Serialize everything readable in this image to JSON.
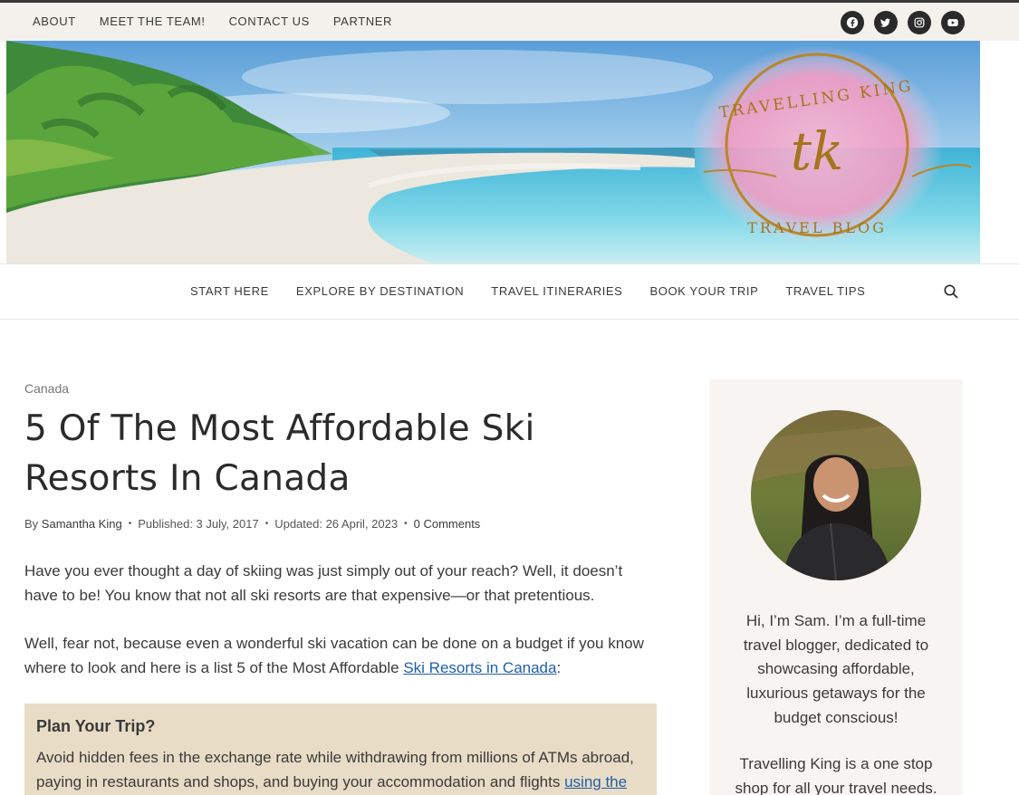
{
  "top_nav": [
    "ABOUT",
    "MEET THE TEAM!",
    "CONTACT US",
    "PARTNER"
  ],
  "social_icons": [
    "facebook-icon",
    "twitter-icon",
    "instagram-icon",
    "youtube-icon"
  ],
  "logo": {
    "text_top": "TRAVELLING KING",
    "monogram": "tk",
    "text_bottom": "TRAVEL BLOG"
  },
  "main_nav": [
    "START HERE",
    "EXPLORE BY DESTINATION",
    "TRAVEL ITINERARIES",
    "BOOK YOUR TRIP",
    "TRAVEL TIPS"
  ],
  "article": {
    "category": "Canada",
    "title": "5 Of The Most Affordable Ski Resorts In Canada",
    "meta": {
      "author_prefix": "By",
      "author": "Samantha King",
      "published": "Published: 3 July, 2017",
      "updated": "Updated: 26 April, 2023",
      "comments": "0 Comments"
    },
    "para1": "Have you ever thought a day of skiing was just simply out of your reach? Well, it doesn’t have to be! You know that not all ski resorts are that expensive—or that pretentious.",
    "para2_before": "Well, fear not, because even a wonderful ski vacation can be done on a budget if you know where to look and here is a list 5 of the Most Affordable ",
    "para2_link": "Ski Resorts in Canada",
    "para2_after": ":",
    "plan": {
      "heading": "Plan Your Trip?",
      "text_before": "Avoid hidden fees in the exchange rate while withdrawing from millions of ATMs abroad, paying in restaurants and shops, and buying your accommodation and flights ",
      "link": "using the Wise"
    }
  },
  "sidebar": {
    "bio1": "Hi, I’m Sam. I’m a full-time travel blogger, dedicated to showcasing affordable, luxurious getaways for the budget conscious!",
    "bio2": "Travelling King is a one stop shop for all your travel needs."
  },
  "colors": {
    "topbar_bg": "#f4f1ec",
    "plan_bg": "#e9dcc6",
    "sidebar_bg": "#f7f4f1",
    "link": "#1f5fa8",
    "logo_gold": "#b8862b",
    "logo_pink": "#f2a6c8"
  }
}
